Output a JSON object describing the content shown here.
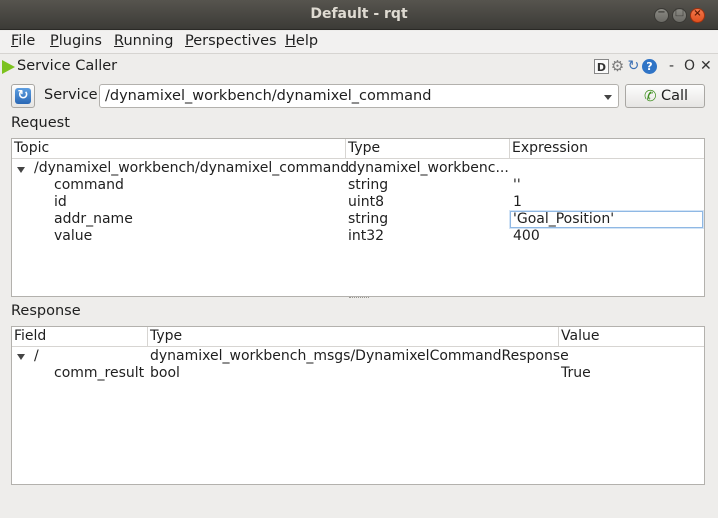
{
  "window": {
    "title": "Default - rqt",
    "minimize": "−",
    "maximize": "□",
    "close": "×"
  },
  "menubar": {
    "items": [
      "File",
      "Plugins",
      "Running",
      "Perspectives",
      "Help"
    ]
  },
  "plugin": {
    "title": "Service Caller",
    "header_icons": [
      "D",
      "⚙",
      "↻",
      "?"
    ],
    "dash": "-",
    "float": "O",
    "close": "✕"
  },
  "service_row": {
    "label": "Service",
    "selected": "/dynamixel_workbench/dynamixel_command",
    "call_label": "Call"
  },
  "request": {
    "label": "Request",
    "columns": [
      "Topic",
      "Type",
      "Expression"
    ],
    "root": {
      "topic": "/dynamixel_workbench/dynamixel_command",
      "type": "dynamixel_workbenc..."
    },
    "rows": [
      {
        "topic": "command",
        "type": "string",
        "expression": "''"
      },
      {
        "topic": "id",
        "type": "uint8",
        "expression": "1"
      },
      {
        "topic": "addr_name",
        "type": "string",
        "expression": "'Goal_Position'"
      },
      {
        "topic": "value",
        "type": "int32",
        "expression": "400"
      }
    ]
  },
  "response": {
    "label": "Response",
    "columns": [
      "Field",
      "Type",
      "Value"
    ],
    "root": {
      "field": "/",
      "type": "dynamixel_workbench_msgs/DynamixelCommandResponse",
      "value": ""
    },
    "rows": [
      {
        "field": "comm_result",
        "type": "bool",
        "value": "True"
      }
    ]
  }
}
